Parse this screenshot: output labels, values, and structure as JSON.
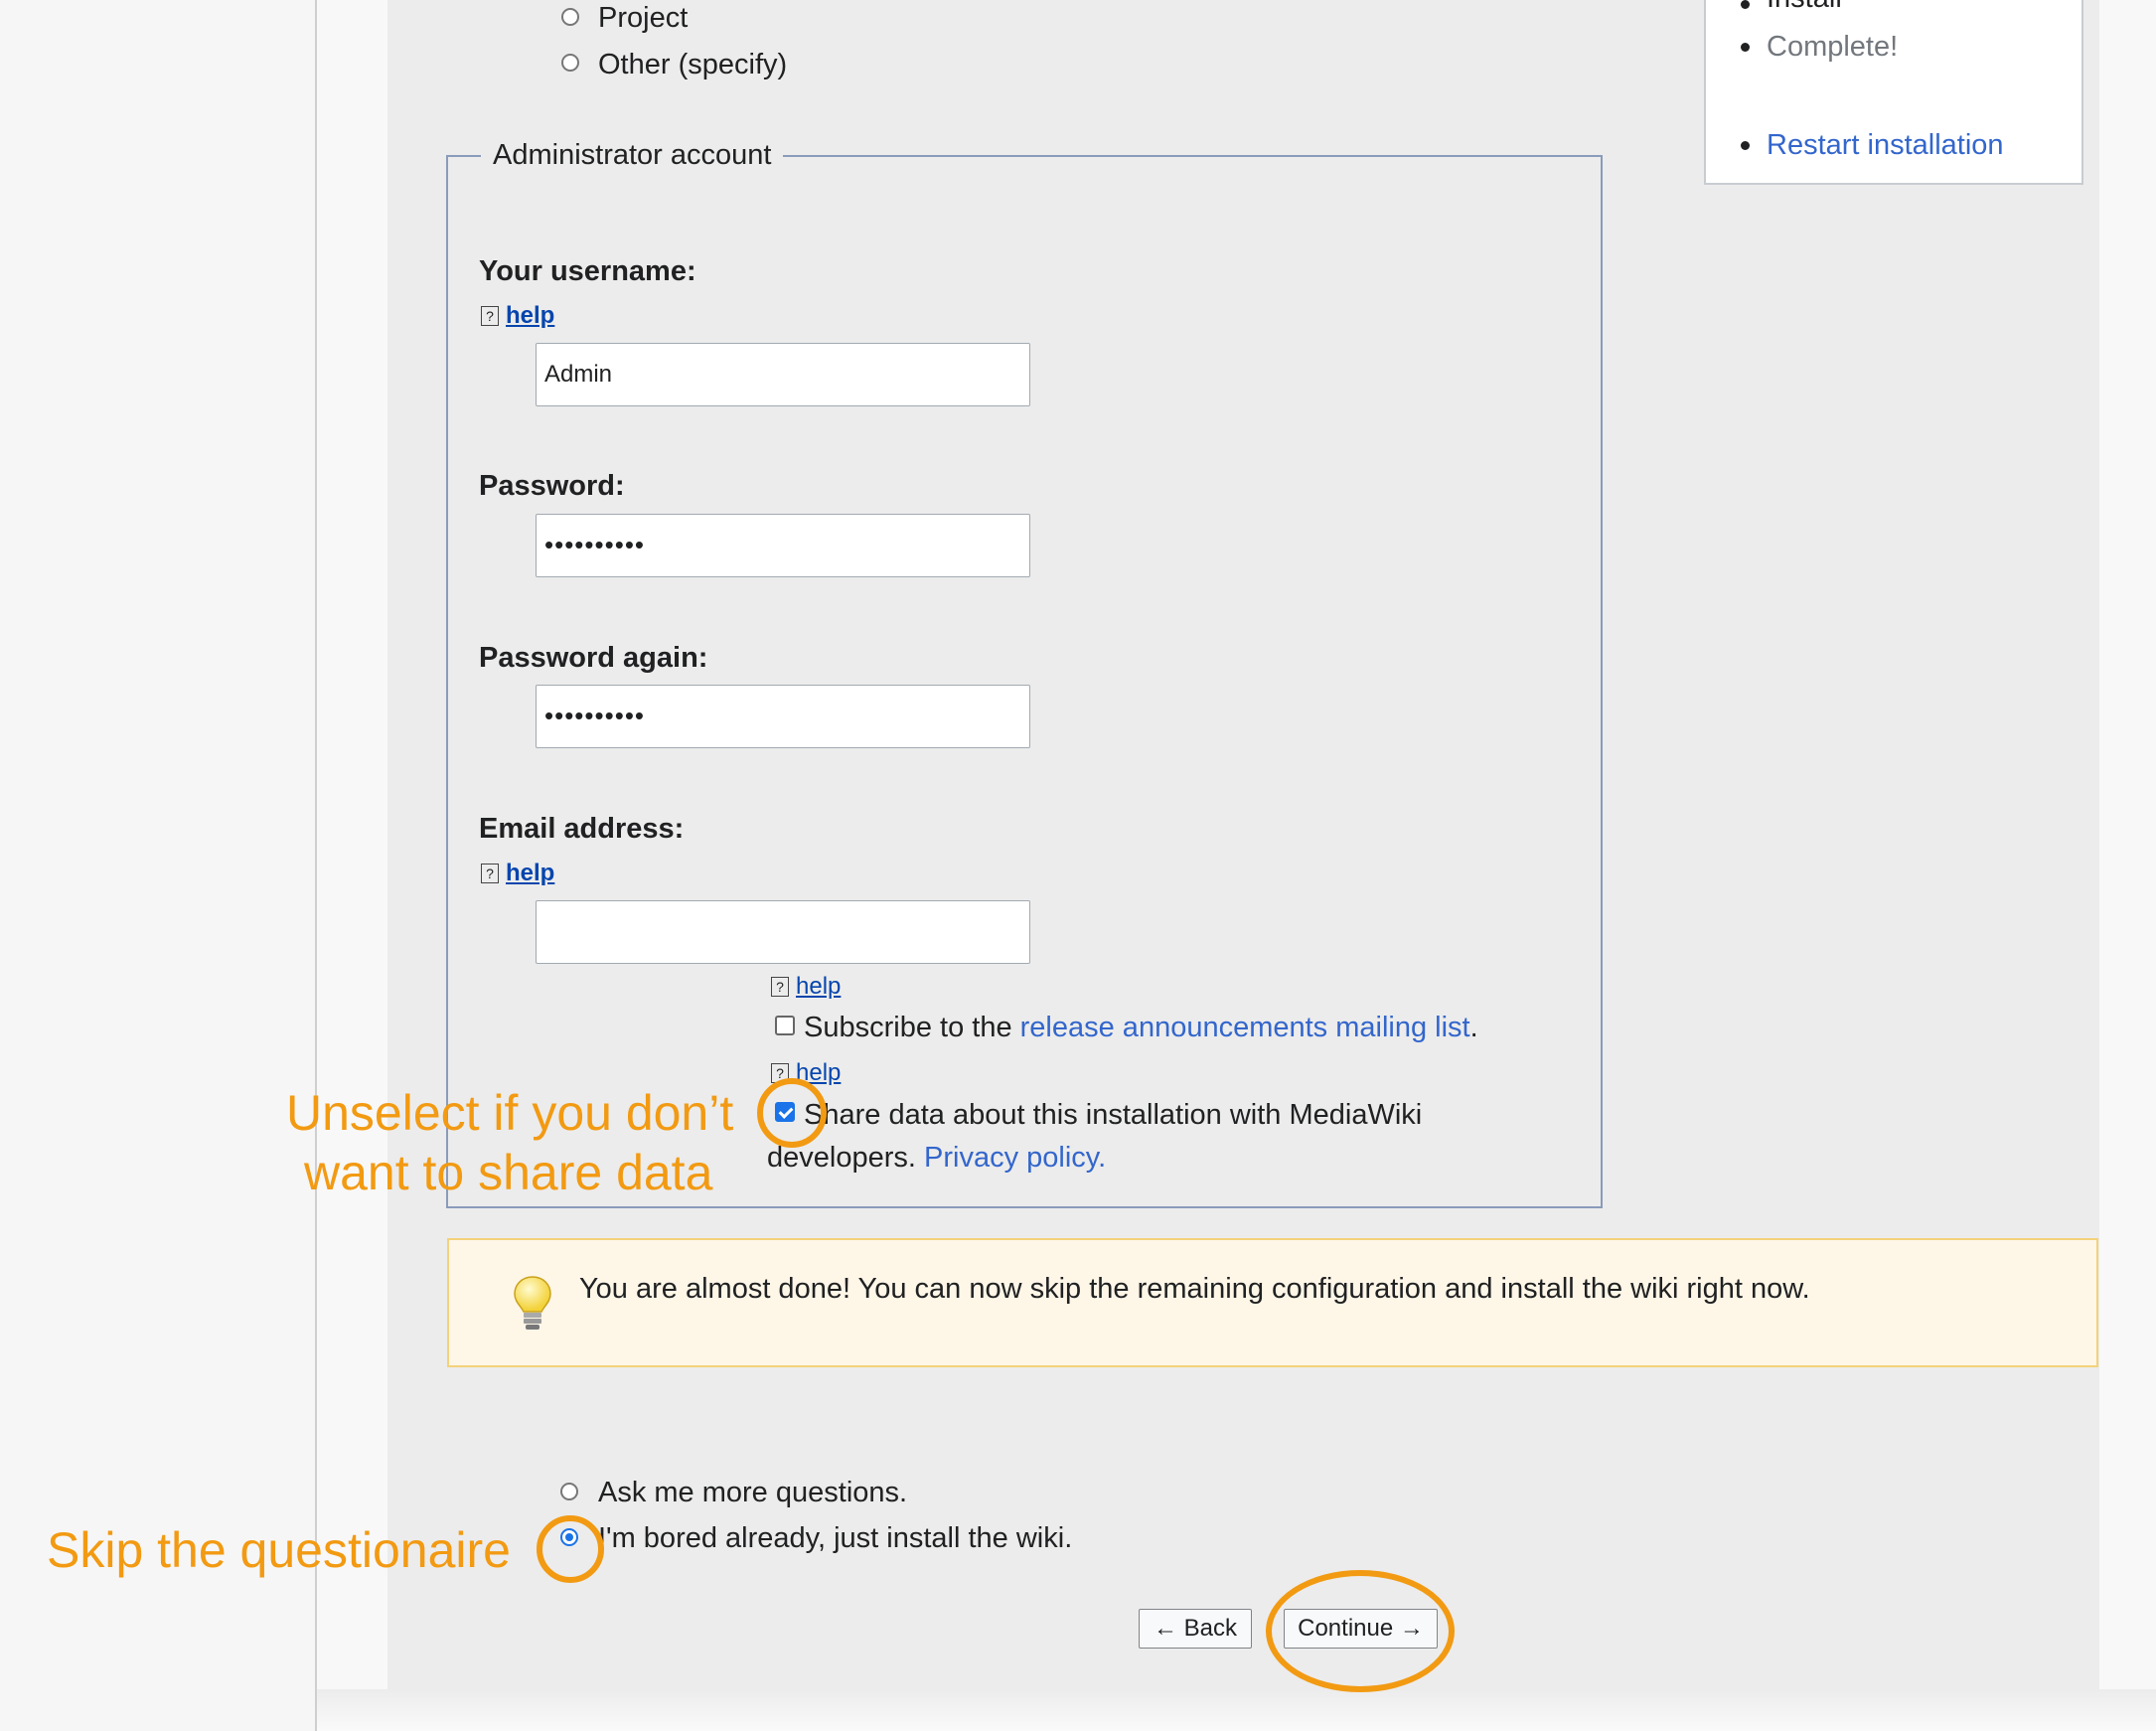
{
  "wiki_type_options": [
    {
      "label": "Project",
      "selected": false
    },
    {
      "label": "Other (specify)",
      "selected": false
    }
  ],
  "sidebar": {
    "steps": [
      "Install",
      "Complete!"
    ],
    "restart_label": "Restart installation"
  },
  "admin_account": {
    "legend": "Administrator account",
    "username_label": "Your username:",
    "username_value": "Admin",
    "password_label": "Password:",
    "password_value": "••••••••••",
    "password_again_label": "Password again:",
    "password_again_value": "••••••••••",
    "email_label": "Email address:",
    "email_value": "",
    "help_label": "help",
    "subscribe": {
      "checked": false,
      "text_before": "Subscribe to the ",
      "link": "release announcements mailing list",
      "text_after": "."
    },
    "share_data": {
      "checked": true,
      "line1": "Share data about this installation with MediaWiki",
      "line2_before": "developers. ",
      "privacy_link": "Privacy policy",
      "line2_after": "."
    }
  },
  "notice": {
    "icon": "lightbulb-icon",
    "text": "You are almost done! You can now skip the remaining configuration and install the wiki right now."
  },
  "next_step": {
    "options": [
      {
        "label": "Ask me more questions.",
        "selected": false
      },
      {
        "label": "I'm bored already, just install the wiki.",
        "selected": true
      }
    ]
  },
  "buttons": {
    "back": "← Back",
    "continue": "Continue →"
  },
  "annotations": {
    "share_line1": "Unselect if you don’t",
    "share_line2": "want to share data",
    "skip": "Skip the questionaire",
    "color": "#f29a12"
  }
}
